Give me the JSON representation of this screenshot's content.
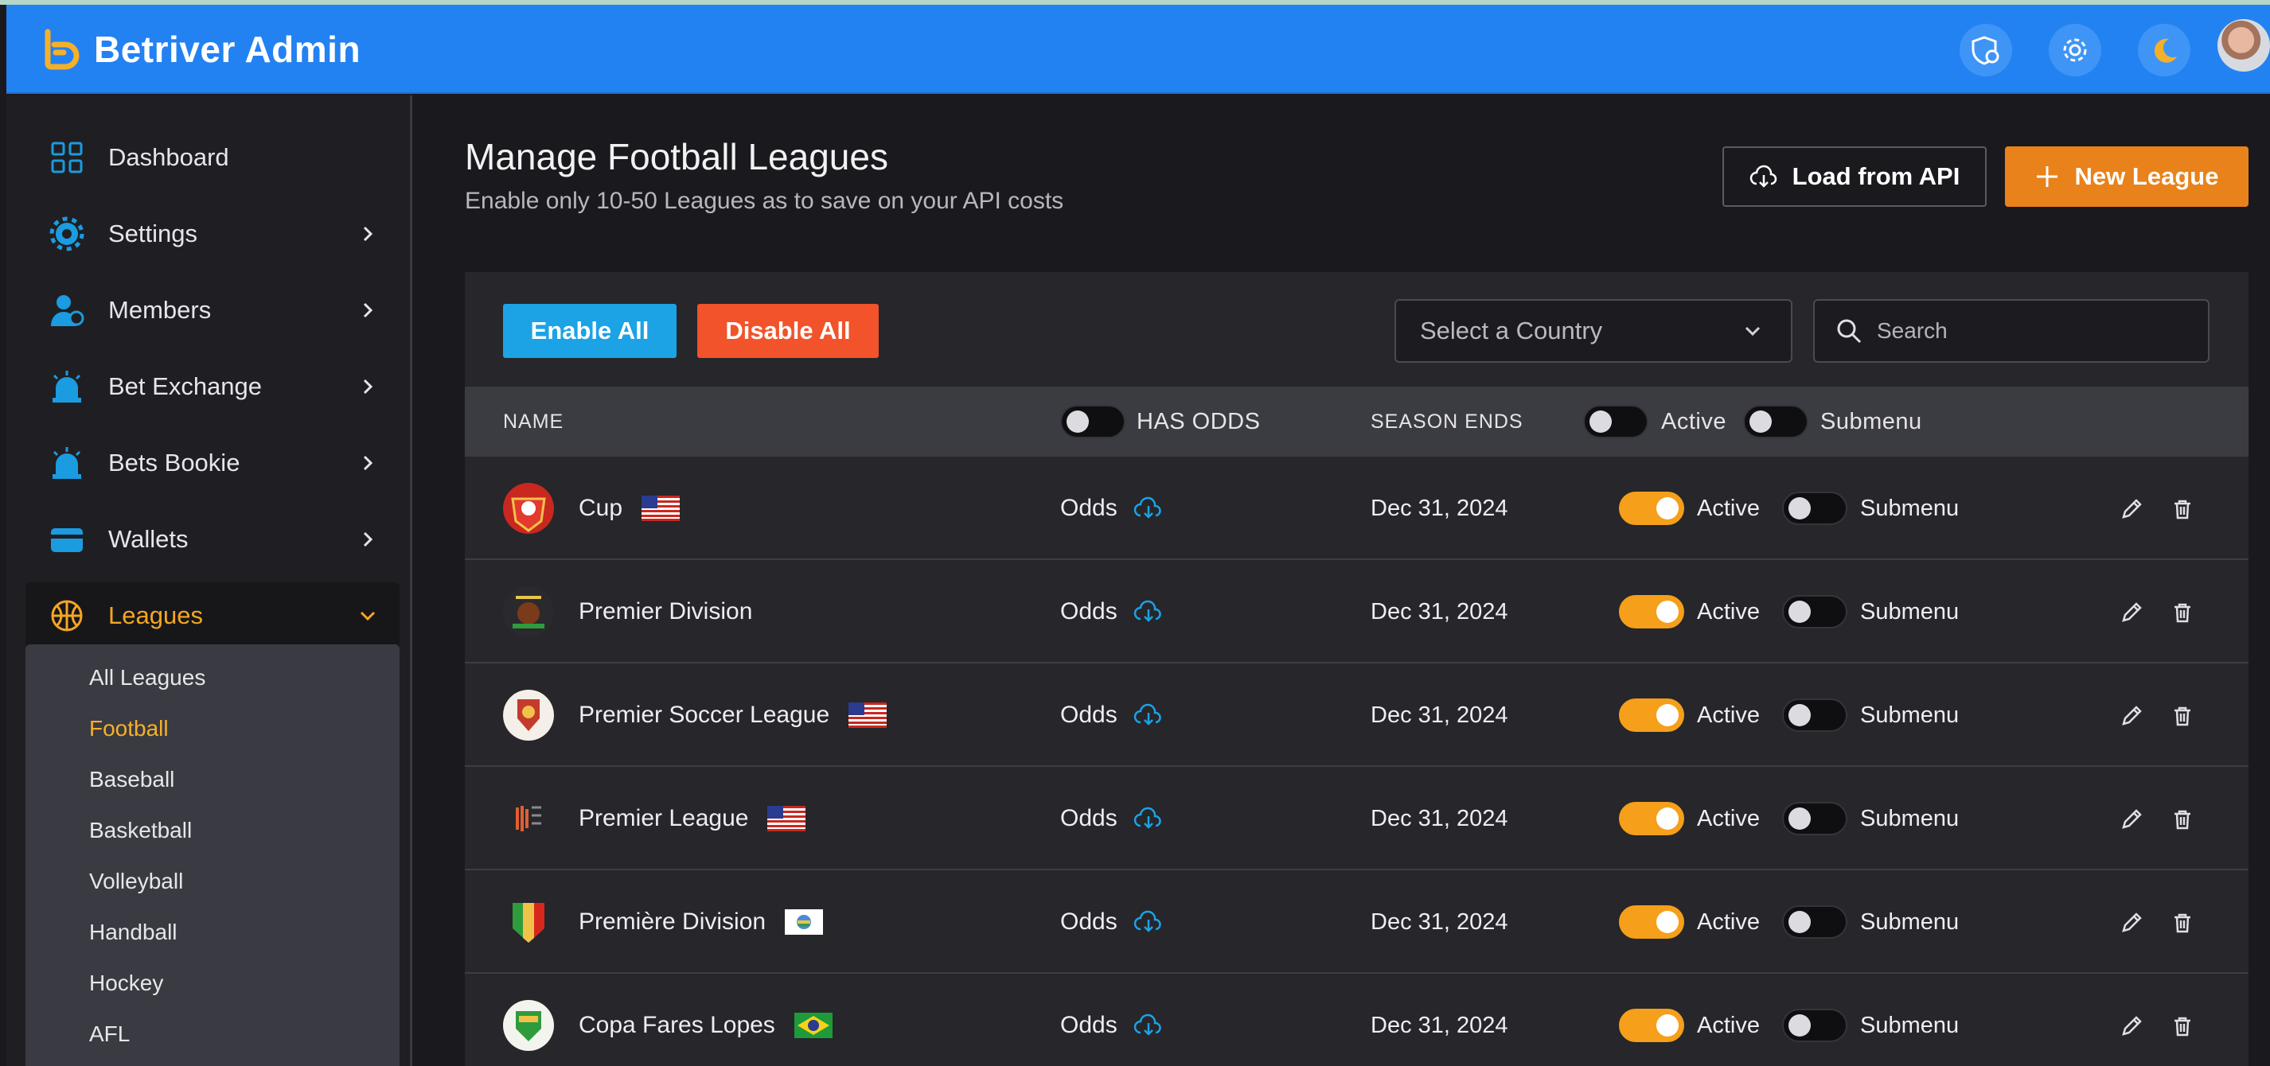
{
  "app": {
    "title": "Betriver Admin"
  },
  "header": {
    "icons": [
      "shield-icon",
      "gear-icon",
      "moon-icon",
      "avatar"
    ]
  },
  "sidebar": {
    "items": [
      {
        "label": "Dashboard",
        "icon": "dashboard-icon"
      },
      {
        "label": "Settings",
        "icon": "gear-icon"
      },
      {
        "label": "Members",
        "icon": "members-icon"
      },
      {
        "label": "Bet Exchange",
        "icon": "alarm-icon"
      },
      {
        "label": "Bets Bookie",
        "icon": "alarm-icon"
      },
      {
        "label": "Wallets",
        "icon": "wallet-icon"
      },
      {
        "label": "Leagues",
        "icon": "basketball-icon"
      }
    ],
    "submenu": [
      "All Leagues",
      "Football",
      "Baseball",
      "Basketball",
      "Volleyball",
      "Handball",
      "Hockey",
      "AFL"
    ]
  },
  "page": {
    "title": "Manage Football Leagues",
    "subtitle": "Enable only 10-50 Leagues as to save on your API costs",
    "load_label": "Load from API",
    "new_label": "New League"
  },
  "toolbar": {
    "enable_all": "Enable All",
    "disable_all": "Disable All",
    "country_placeholder": "Select a Country",
    "search_placeholder": "Search"
  },
  "table": {
    "headers": {
      "name": "NAME",
      "has_odds": "HAS ODDS",
      "season_ends": "SEASON ENDS",
      "active": "Active",
      "submenu": "Submenu"
    },
    "rows": [
      {
        "name": "Cup",
        "flag": "us",
        "odds": "Odds",
        "season_ends": "Dec 31, 2024",
        "active_label": "Active",
        "active": true,
        "submenu_label": "Submenu",
        "submenu": false
      },
      {
        "name": "Premier Division",
        "flag": "",
        "odds": "Odds",
        "season_ends": "Dec 31, 2024",
        "active_label": "Active",
        "active": true,
        "submenu_label": "Submenu",
        "submenu": false
      },
      {
        "name": "Premier Soccer League",
        "flag": "us",
        "odds": "Odds",
        "season_ends": "Dec 31, 2024",
        "active_label": "Active",
        "active": true,
        "submenu_label": "Submenu",
        "submenu": false
      },
      {
        "name": "Premier League",
        "flag": "us",
        "odds": "Odds",
        "season_ends": "Dec 31, 2024",
        "active_label": "Active",
        "active": true,
        "submenu_label": "Submenu",
        "submenu": false
      },
      {
        "name": "Première Division",
        "flag": "ls",
        "odds": "Odds",
        "season_ends": "Dec 31, 2024",
        "active_label": "Active",
        "active": true,
        "submenu_label": "Submenu",
        "submenu": false
      },
      {
        "name": "Copa Fares Lopes",
        "flag": "br",
        "odds": "Odds",
        "season_ends": "Dec 31, 2024",
        "active_label": "Active",
        "active": true,
        "submenu_label": "Submenu",
        "submenu": false
      }
    ]
  },
  "colors": {
    "header": "#2382f2",
    "accent": "#f5a623",
    "enable": "#1ba3e5",
    "disable": "#f2532a",
    "new": "#e9821a"
  }
}
